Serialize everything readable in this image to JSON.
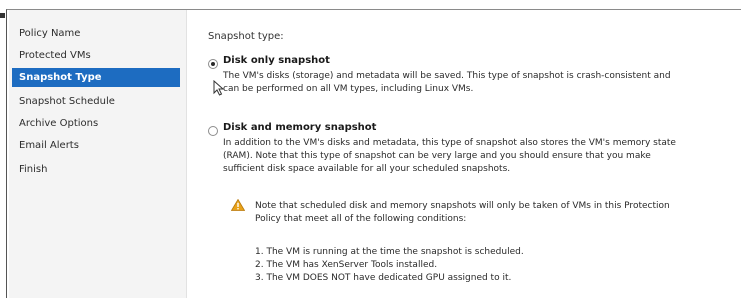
{
  "sidebar": {
    "items": [
      {
        "label": "Policy Name",
        "active": false
      },
      {
        "label": "Protected VMs",
        "active": false
      },
      {
        "label": "Snapshot Type",
        "active": true
      },
      {
        "label": "Snapshot Schedule",
        "active": false
      },
      {
        "label": "Archive Options",
        "active": false
      },
      {
        "label": "Email Alerts",
        "active": false
      },
      {
        "label": "Finish",
        "active": false
      }
    ]
  },
  "main": {
    "section_label": "Snapshot type:",
    "option_disk_only": {
      "label": "Disk only snapshot",
      "desc_line1": "The VM's disks (storage) and metadata will be saved. This type of snapshot is crash-consistent and",
      "desc_line2": "can be performed on all VM types, including Linux VMs.",
      "selected": true
    },
    "option_disk_memory": {
      "label": "Disk and memory snapshot",
      "desc_line1": "In addition to the VM's disks and metadata, this type of snapshot also stores the VM's memory state",
      "desc_line2": "(RAM). Note that this type of snapshot can be very large and you should ensure that you make",
      "desc_line3": "sufficient disk space available for all your scheduled snapshots.",
      "selected": false
    },
    "warning": {
      "line1": "Note that scheduled disk and memory snapshots will only be taken of VMs in this Protection",
      "line2": "Policy that meet all of the following conditions:",
      "conditions": [
        "1. The VM is running at the time the snapshot is scheduled.",
        "2. The VM has XenServer Tools installed.",
        "3. The VM DOES NOT have dedicated GPU assigned to it."
      ]
    }
  },
  "icons": {
    "warning": "warning-triangle-icon",
    "cursor": "mouse-pointer-icon"
  },
  "colors": {
    "accent": "#1d6cc1",
    "warning": "#e8a21a"
  }
}
